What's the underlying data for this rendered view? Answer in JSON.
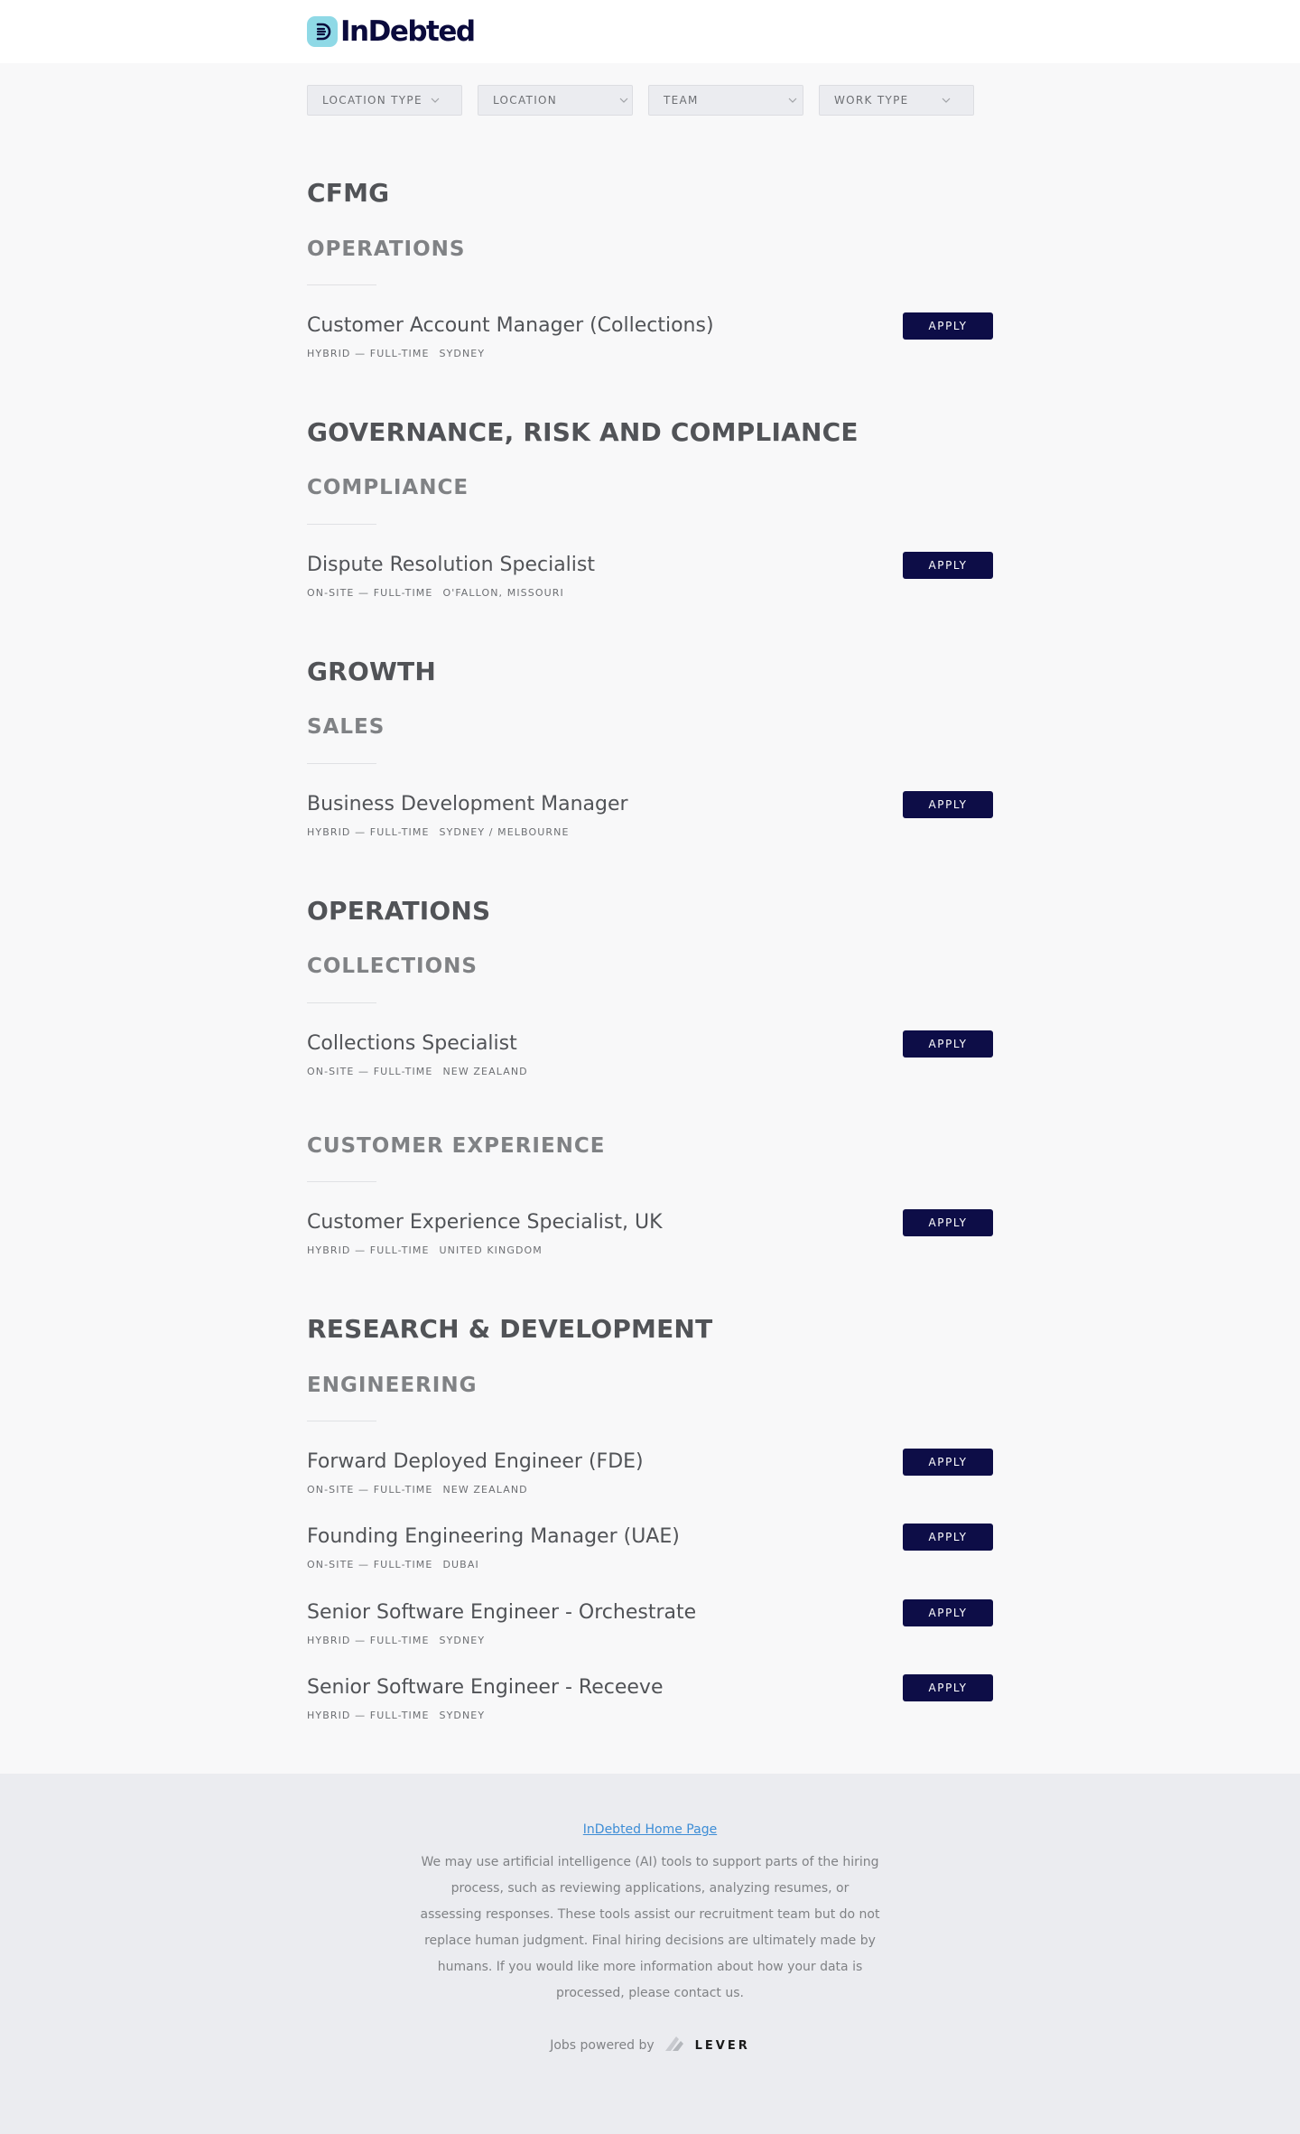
{
  "header": {
    "logo_text": "InDebted"
  },
  "filters": [
    {
      "label": "LOCATION TYPE"
    },
    {
      "label": "LOCATION"
    },
    {
      "label": "TEAM"
    },
    {
      "label": "WORK TYPE"
    }
  ],
  "groups": [
    {
      "title": "CFMG",
      "teams": [
        {
          "title": "OPERATIONS",
          "postings": [
            {
              "title": "Customer Account Manager (Collections)",
              "commitment": "HYBRID — FULL-TIME",
              "location": "SYDNEY",
              "apply": "APPLY"
            }
          ]
        }
      ]
    },
    {
      "title": "GOVERNANCE, RISK AND COMPLIANCE",
      "teams": [
        {
          "title": "COMPLIANCE",
          "postings": [
            {
              "title": "Dispute Resolution Specialist",
              "commitment": "ON-SITE — FULL-TIME",
              "location": "O'FALLON, MISSOURI",
              "apply": "APPLY"
            }
          ]
        }
      ]
    },
    {
      "title": "GROWTH",
      "teams": [
        {
          "title": "SALES",
          "postings": [
            {
              "title": "Business Development Manager",
              "commitment": "HYBRID — FULL-TIME",
              "location": "SYDNEY / MELBOURNE",
              "apply": "APPLY"
            }
          ]
        }
      ]
    },
    {
      "title": "OPERATIONS",
      "teams": [
        {
          "title": "COLLECTIONS",
          "postings": [
            {
              "title": "Collections Specialist",
              "commitment": "ON-SITE — FULL-TIME",
              "location": "NEW ZEALAND",
              "apply": "APPLY"
            }
          ]
        },
        {
          "title": "CUSTOMER EXPERIENCE",
          "postings": [
            {
              "title": "Customer Experience Specialist, UK",
              "commitment": "HYBRID — FULL-TIME",
              "location": "UNITED KINGDOM",
              "apply": "APPLY"
            }
          ]
        }
      ]
    },
    {
      "title": "RESEARCH & DEVELOPMENT",
      "teams": [
        {
          "title": "ENGINEERING",
          "postings": [
            {
              "title": "Forward Deployed Engineer (FDE)",
              "commitment": "ON-SITE — FULL-TIME",
              "location": "NEW ZEALAND",
              "apply": "APPLY"
            },
            {
              "title": "Founding Engineering Manager (UAE)",
              "commitment": "ON-SITE — FULL-TIME",
              "location": "DUBAI",
              "apply": "APPLY"
            },
            {
              "title": "Senior Software Engineer - Orchestrate",
              "commitment": "HYBRID — FULL-TIME",
              "location": "SYDNEY",
              "apply": "APPLY"
            },
            {
              "title": "Senior Software Engineer - Receeve",
              "commitment": "HYBRID — FULL-TIME",
              "location": "SYDNEY",
              "apply": "APPLY"
            }
          ]
        }
      ]
    }
  ],
  "footer": {
    "home_link": "InDebted Home Page",
    "note": "We may use artificial intelligence (AI) tools to support parts of the hiring process, such as reviewing applications, analyzing resumes, or assessing responses. These tools assist our recruitment team but do not replace human judgment. Final hiring decisions are ultimately made by humans. If you would like more information about how your data is processed, please contact us.",
    "powered_by": "Jobs powered by",
    "lever_brand": "LEVER"
  },
  "icons": {
    "logo": "indebted-logo-icon",
    "filter_chevron": "chevron-down-icon",
    "lever": "lever-logo-icon"
  },
  "colors": {
    "brand_navy": "#0d0d47",
    "logo_teal": "#8fd9e6",
    "link_blue": "#3d8dd6",
    "page_bg": "#f8f8f9",
    "footer_bg": "#ebecf0"
  }
}
